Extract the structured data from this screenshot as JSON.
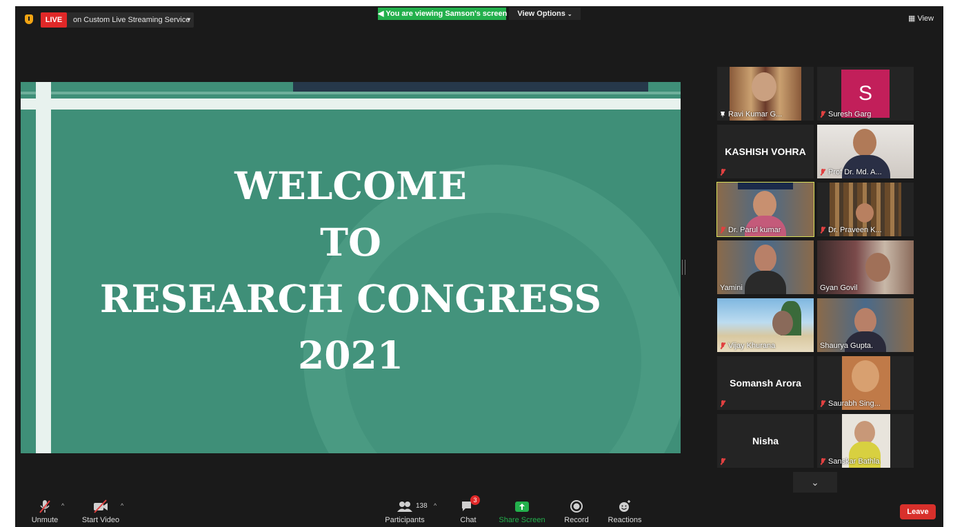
{
  "topbar": {
    "live_label": "LIVE",
    "live_service": "on Custom Live Streaming Service",
    "viewing_banner": "You are viewing Samson's screen",
    "view_options": "View Options",
    "view_button": "View"
  },
  "slide": {
    "lines": [
      "WELCOME",
      "TO",
      "RESEARCH CONGRESS",
      "2021"
    ]
  },
  "participants": [
    {
      "name": "Ravi Kumar G..."
    },
    {
      "name": "Suresh Garg",
      "avatar_letter": "S"
    },
    {
      "name": "KASHISH VOHRA"
    },
    {
      "name": "Prof Dr. Md. A..."
    },
    {
      "name": "Dr. Parul kumar"
    },
    {
      "name": "Dr. Praveen K..."
    },
    {
      "name": "Yamini"
    },
    {
      "name": "Gyan Govil"
    },
    {
      "name": "Vijay Khurana"
    },
    {
      "name": "Shaurya Gupta."
    },
    {
      "name": "Somansh Arora"
    },
    {
      "name": "Saurabh Sing..."
    },
    {
      "name": "Nisha"
    },
    {
      "name": "Sanskar Bathla"
    }
  ],
  "toolbar": {
    "unmute": "Unmute",
    "start_video": "Start Video",
    "participants": "Participants",
    "participants_count": "138",
    "chat": "Chat",
    "chat_badge": "3",
    "share_screen": "Share Screen",
    "record": "Record",
    "reactions": "Reactions",
    "leave": "Leave"
  },
  "colors": {
    "app_bg": "#1a1a1a",
    "live_red": "#e02828",
    "banner_green": "#23b04c",
    "slide_green": "#3f8f78",
    "active_speaker": "#d9e05b",
    "leave_red": "#d8302b"
  }
}
